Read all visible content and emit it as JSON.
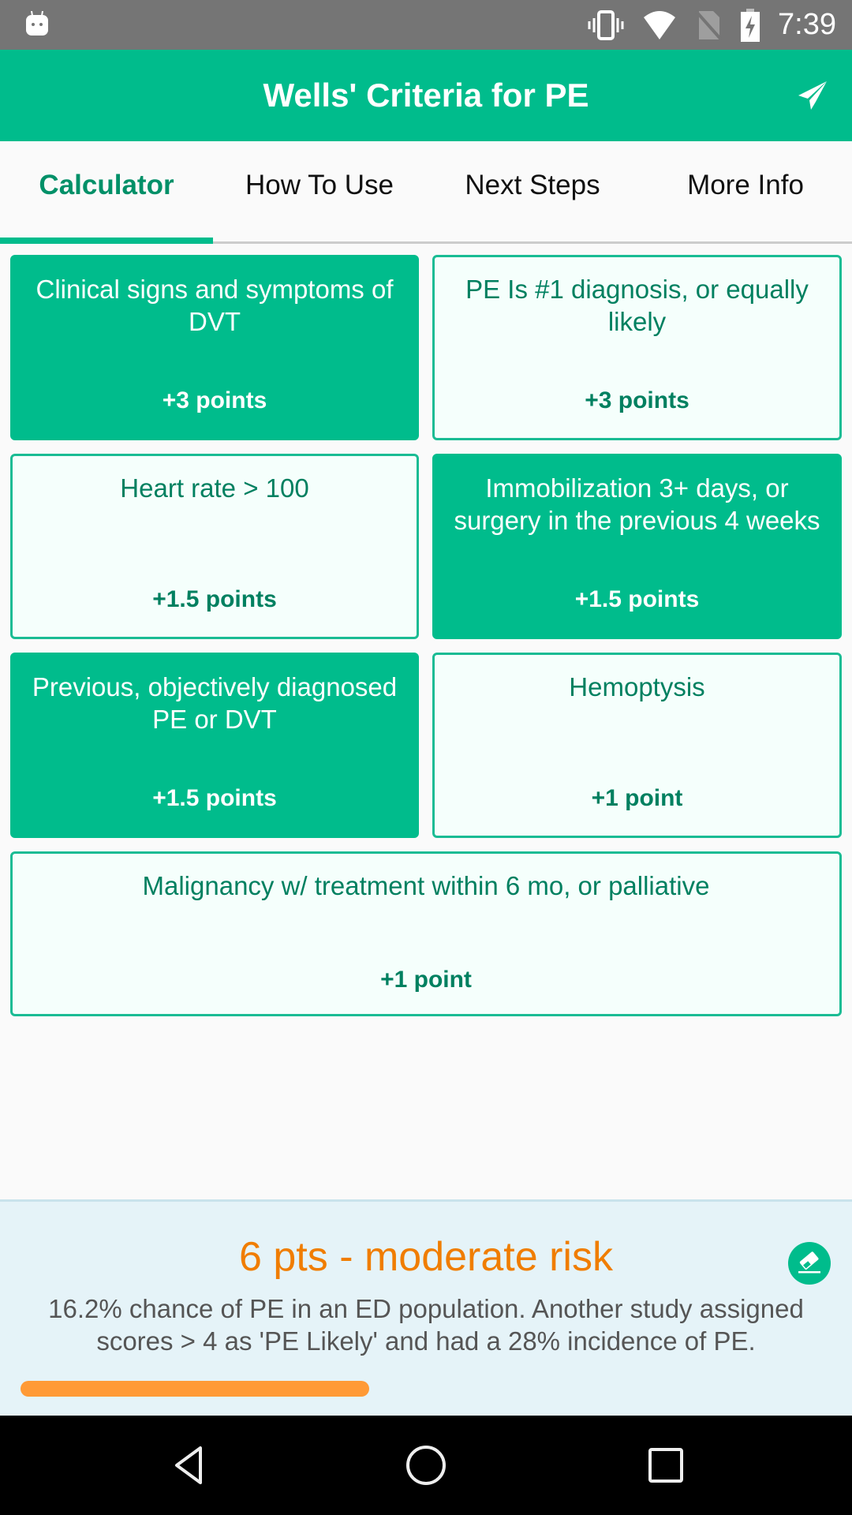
{
  "status_bar": {
    "time": "7:39",
    "icons": [
      "android-debug-icon",
      "vibrate-icon",
      "wifi-icon",
      "no-sim-icon",
      "battery-charging-icon"
    ]
  },
  "app_bar": {
    "title": "Wells' Criteria for PE",
    "action_icon": "send-icon"
  },
  "tabs": [
    {
      "label": "Calculator",
      "active": true
    },
    {
      "label": "How To Use",
      "active": false
    },
    {
      "label": "Next Steps",
      "active": false
    },
    {
      "label": "More Info",
      "active": false
    }
  ],
  "criteria": [
    {
      "label": "Clinical signs and symptoms of DVT",
      "points": "+3 points",
      "selected": true
    },
    {
      "label": "PE Is #1 diagnosis, or equally likely",
      "points": "+3 points",
      "selected": false
    },
    {
      "label": "Heart rate > 100",
      "points": "+1.5 points",
      "selected": false
    },
    {
      "label": "Immobilization 3+ days, or surgery in the previous 4 weeks",
      "points": "+1.5 points",
      "selected": true
    },
    {
      "label": "Previous, objectively diagnosed PE or DVT",
      "points": "+1.5 points",
      "selected": true
    },
    {
      "label": "Hemoptysis",
      "points": "+1 point",
      "selected": false
    },
    {
      "label": "Malignancy w/ treatment within 6 mo, or palliative",
      "points": "+1 point",
      "selected": false
    }
  ],
  "result": {
    "score_text": "6 pts - moderate risk",
    "description": "16.2% chance of PE in an ED population. Another study assigned scores > 4 as 'PE Likely' and had a 28% incidence of PE.",
    "risk_fraction": 0.43,
    "risk_color": "#ff9a36",
    "clear_icon": "eraser-icon"
  },
  "colors": {
    "primary": "#00bc8c",
    "primary_dark_text": "#008060",
    "risk_text": "#f07d00"
  },
  "nav_bar": {
    "buttons": [
      "back",
      "home",
      "recents"
    ]
  }
}
